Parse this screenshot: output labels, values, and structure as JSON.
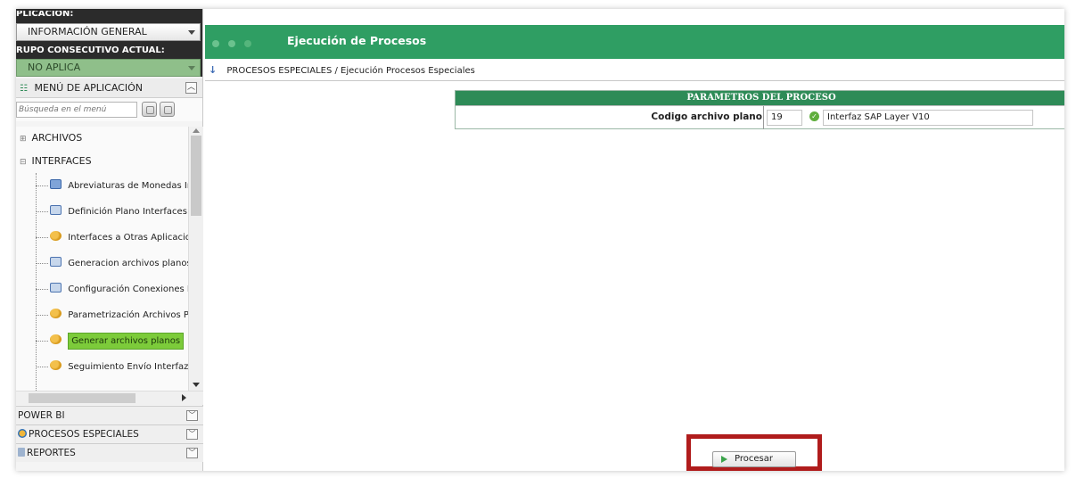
{
  "sidebar": {
    "app_label": "PLICACION:",
    "app_value": "INFORMACIÓN GENERAL",
    "group_label": "RUPO CONSECUTIVO ACTUAL:",
    "group_value": "NO APLICA",
    "menu_title": "MENÚ DE APLICACIÓN",
    "search_placeholder": "Búsqueda en el menú",
    "folders": [
      "ARCHIVOS",
      "INTERFACES"
    ],
    "items": [
      {
        "label": "Abreviaturas de Monedas Inte",
        "icon": "grid-icon"
      },
      {
        "label": "Definición Plano Interfaces",
        "icon": "form-icon"
      },
      {
        "label": "Interfaces a Otras Aplicacione:",
        "icon": "gear-icon"
      },
      {
        "label": "Generacion archivos planos",
        "icon": "form-icon"
      },
      {
        "label": "Configuración Conexiones Inte",
        "icon": "form-icon"
      },
      {
        "label": "Parametrización Archivos Plan·",
        "icon": "gear-icon"
      },
      {
        "label": "Generar archivos planos",
        "icon": "gear-icon",
        "active": true
      },
      {
        "label": "Seguimiento Envío Interfaz",
        "icon": "gear-icon"
      }
    ],
    "accordions": [
      "POWER BI",
      "PROCESOS ESPECIALES",
      "REPORTES"
    ]
  },
  "header": {
    "title": "Ejecución de Procesos"
  },
  "breadcrumb": {
    "text": "PROCESOS ESPECIALES / Ejecución Procesos Especiales"
  },
  "params": {
    "heading": "PARAMETROS DEL PROCESO",
    "field_label": "Codigo archivo plano",
    "code_value": "19",
    "description_value": "Interfaz SAP Layer V10"
  },
  "actions": {
    "process_label": "Procesar"
  },
  "colors": {
    "header_green": "#2f9e63",
    "active_item": "#7ccb3a",
    "highlight_red": "#b01c1c"
  }
}
